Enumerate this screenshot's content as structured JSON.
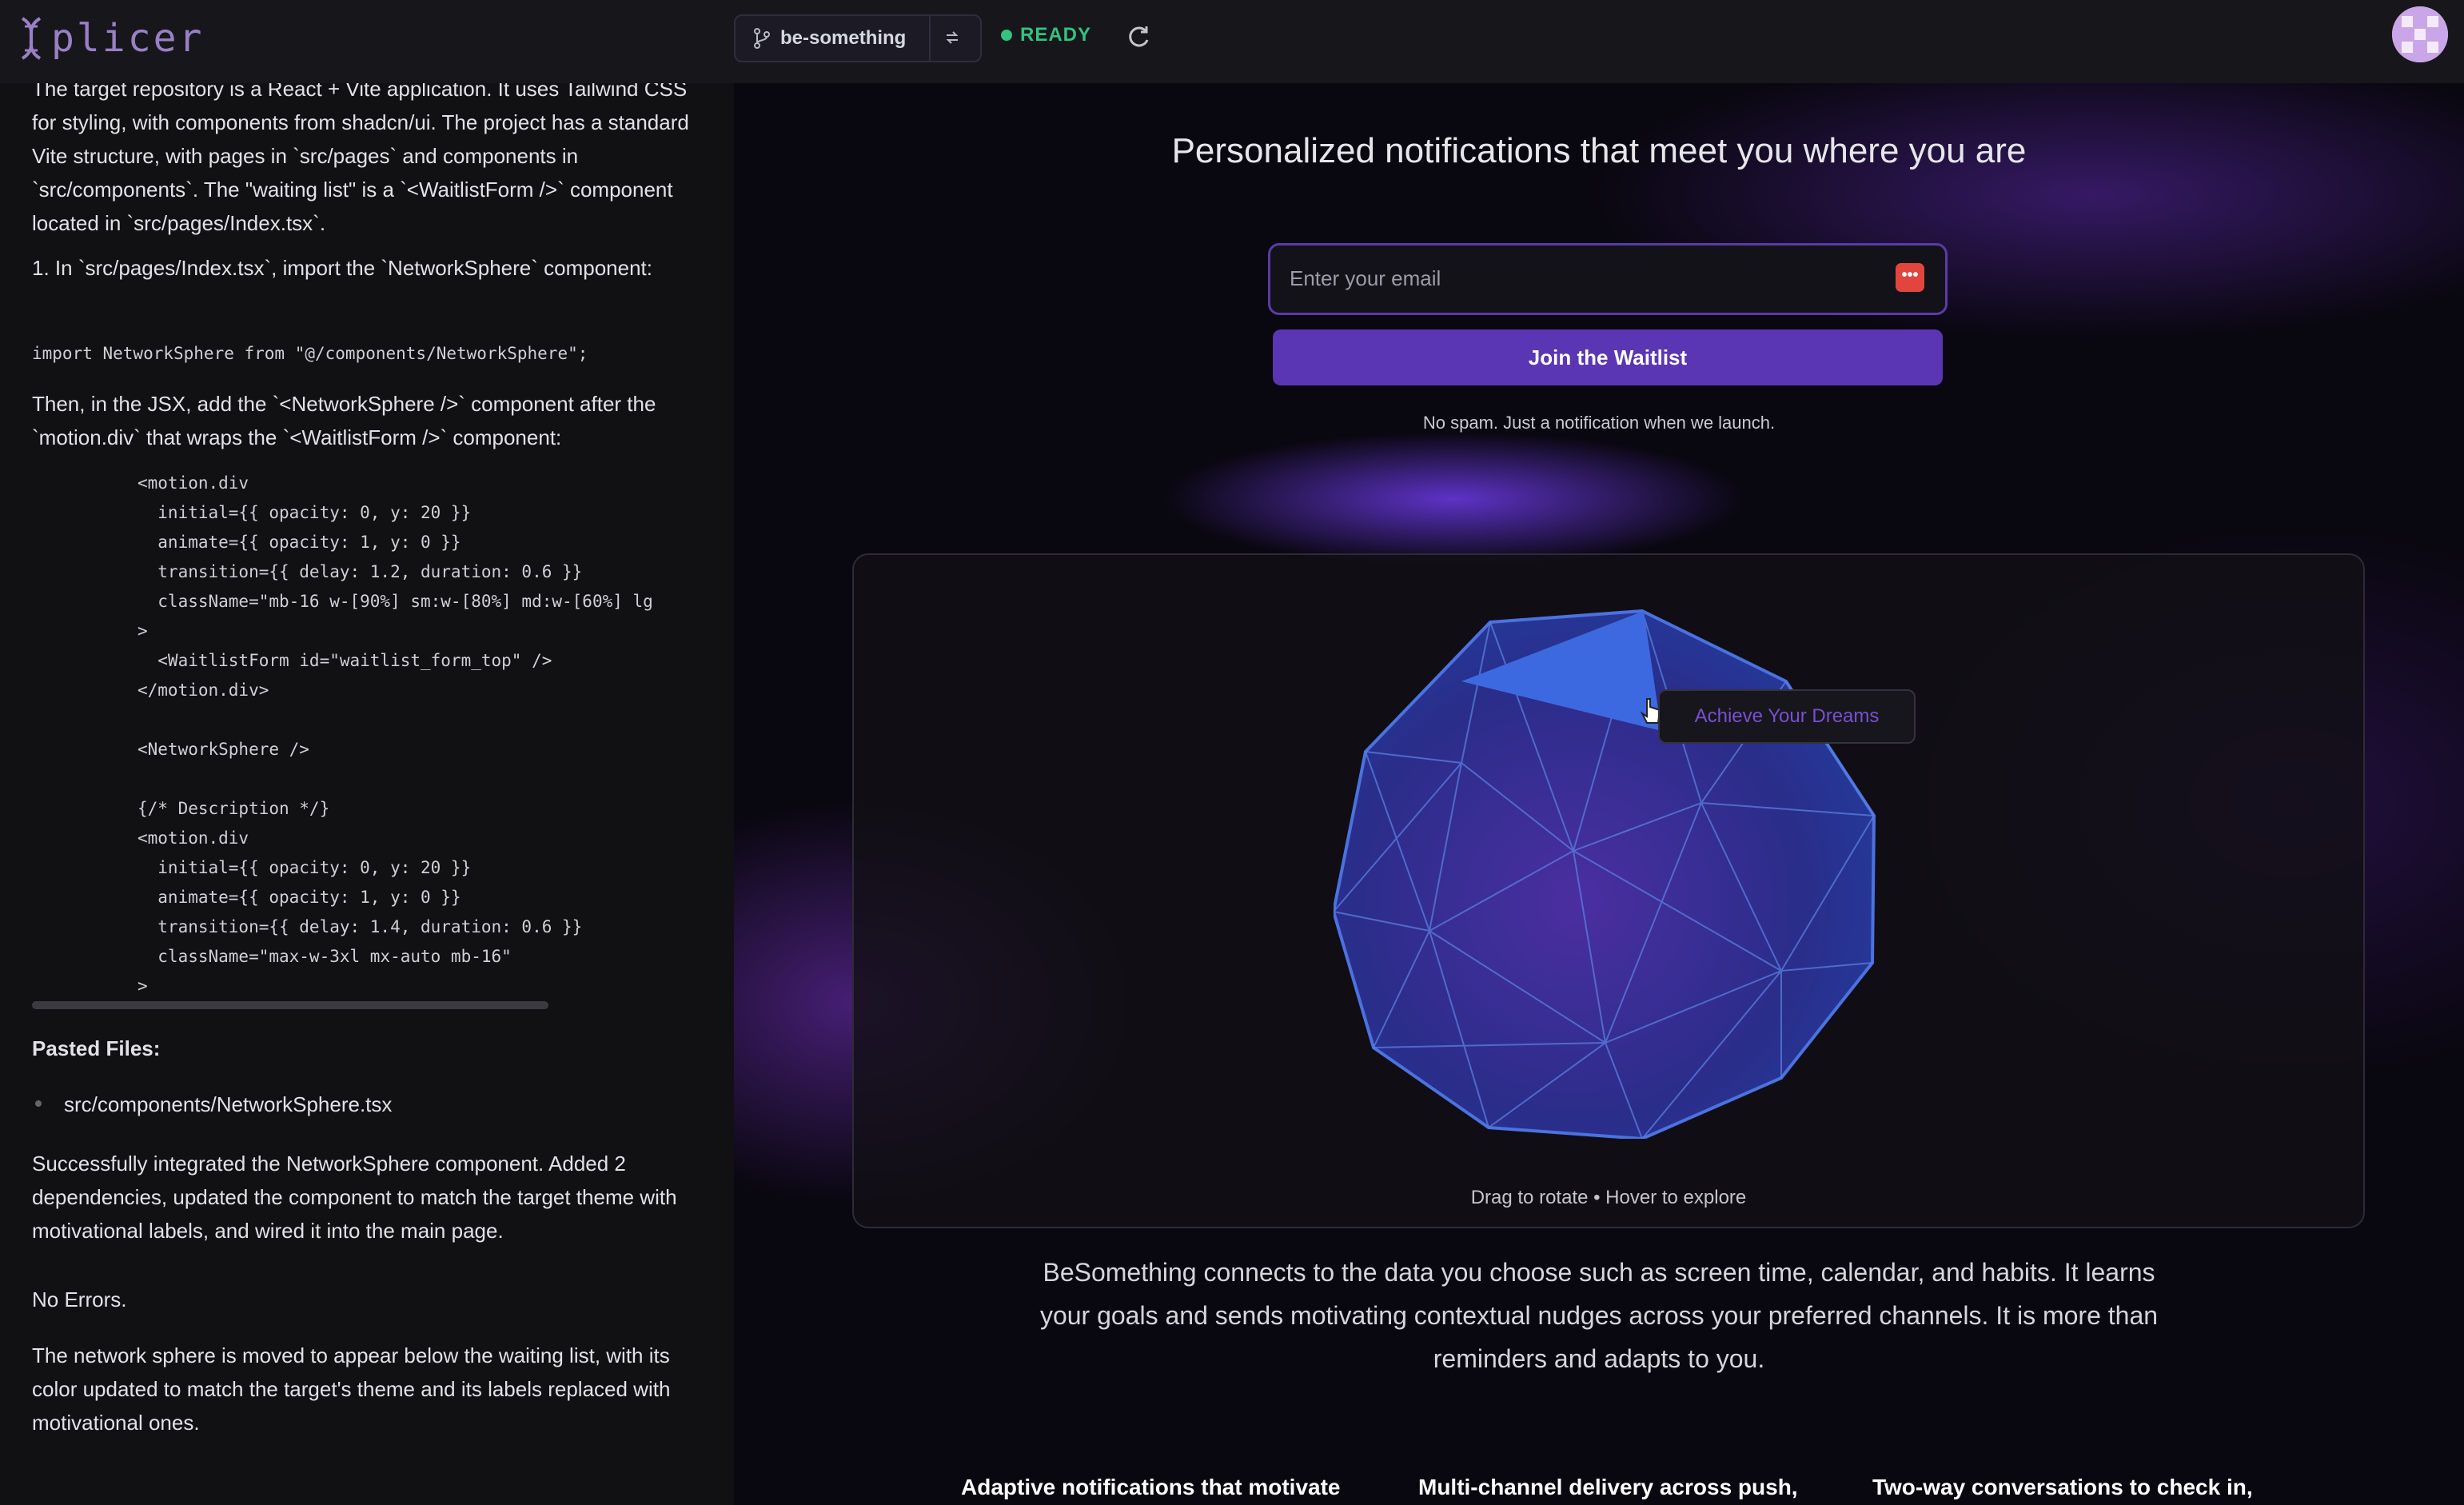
{
  "header": {
    "logo_text": "plicer",
    "branch": "be-something",
    "status": "READY",
    "colors": {
      "status": "#33c27f",
      "accent": "#5a36b4"
    }
  },
  "chat": {
    "para1": "The target repository is a React + Vite application. It uses Tailwind CSS for styling, with components from shadcn/ui. The project has a standard Vite structure, with pages in `src/pages` and components in `src/components`. The \"waiting list\" is a `<WaitlistForm />` component located in `src/pages/Index.tsx`.",
    "step1_text": "1.  In `src/pages/Index.tsx`, import the `NetworkSphere` component:",
    "import_line": "import NetworkSphere from \"@/components/NetworkSphere\";",
    "para2": "Then, in the JSX, add the `<NetworkSphere />` component after the `motion.div` that wraps the `<WaitlistForm />` component:",
    "code_block": "<motion.div\n  initial={{ opacity: 0, y: 20 }}\n  animate={{ opacity: 1, y: 0 }}\n  transition={{ delay: 1.2, duration: 0.6 }}\n  className=\"mb-16 w-[90%] sm:w-[80%] md:w-[60%] lg\n>\n  <WaitlistForm id=\"waitlist_form_top\" />\n</motion.div>\n\n<NetworkSphere />\n\n{/* Description */}\n<motion.div\n  initial={{ opacity: 0, y: 20 }}\n  animate={{ opacity: 1, y: 0 }}\n  transition={{ delay: 1.4, duration: 0.6 }}\n  className=\"max-w-3xl mx-auto mb-16\"\n>",
    "pasted_heading": "Pasted Files:",
    "pasted_file": "src/components/NetworkSphere.tsx",
    "para3": "Successfully integrated the NetworkSphere component. Added 2 dependencies, updated the component to match the target theme with motivational labels, and wired it into the main page.",
    "para4": "No Errors.",
    "para5": "The network sphere is moved to appear below the waiting list, with its color updated to match the target's theme and its labels replaced with motivational ones."
  },
  "preview": {
    "title": "Personalized notifications that meet you where you are",
    "email_placeholder": "Enter your email",
    "join_button": "Join the Waitlist",
    "no_spam": "No spam. Just a notification when we launch.",
    "sphere_tooltip": "Achieve Your Dreams",
    "sphere_hint": "Drag to rotate • Hover to explore",
    "description": "BeSomething connects to the data you choose such as screen time, calendar, and habits. It learns your goals and sends motivating contextual nudges across your preferred channels. It is more than reminders and adapts to you.",
    "features": [
      "Adaptive notifications that motivate",
      "Multi-channel delivery across push,",
      "Two-way conversations to check in,"
    ]
  }
}
